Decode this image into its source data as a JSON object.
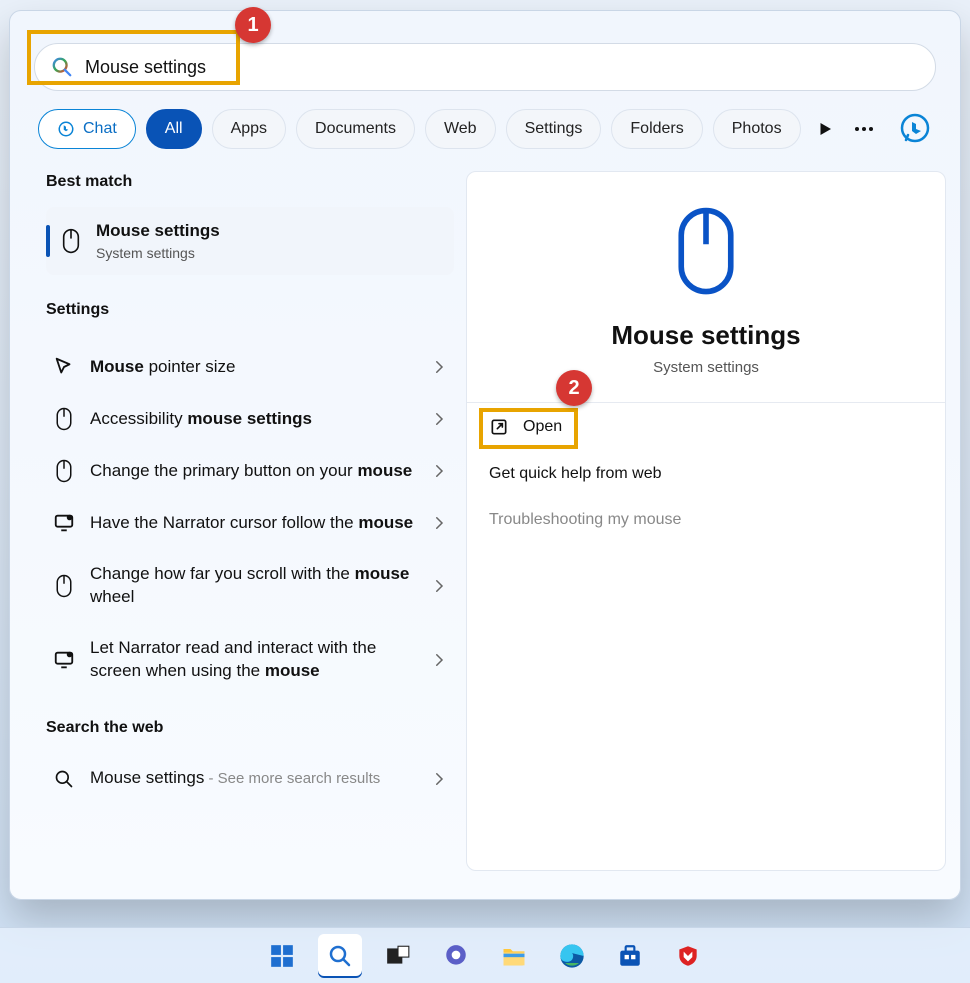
{
  "search": {
    "query": "Mouse settings"
  },
  "filters": {
    "chat": "Chat",
    "all": "All",
    "apps": "Apps",
    "documents": "Documents",
    "web": "Web",
    "settings": "Settings",
    "folders": "Folders",
    "photos": "Photos"
  },
  "sections": {
    "best_match": "Best match",
    "settings": "Settings",
    "search_web": "Search the web"
  },
  "best_match": {
    "title": "Mouse settings",
    "subtitle": "System settings"
  },
  "settings_items": [
    {
      "pre": "",
      "bold": "Mouse",
      "post": " pointer size"
    },
    {
      "pre": "Accessibility ",
      "bold": "mouse settings",
      "post": ""
    },
    {
      "pre": "Change the primary button on your ",
      "bold": "mouse",
      "post": ""
    },
    {
      "pre": "Have the Narrator cursor follow the ",
      "bold": "mouse",
      "post": ""
    },
    {
      "pre": "Change how far you scroll with the ",
      "bold": "mouse",
      "post": " wheel"
    },
    {
      "pre": "Let Narrator read and interact with the screen when using the ",
      "bold": "mouse",
      "post": ""
    }
  ],
  "web_item": {
    "title": "Mouse settings",
    "sub": " - See more search results"
  },
  "detail": {
    "title": "Mouse settings",
    "subtitle": "System settings",
    "open": "Open",
    "help": "Get quick help from web",
    "troubleshoot": "Troubleshooting my mouse"
  },
  "annotations": {
    "one": "1",
    "two": "2"
  }
}
